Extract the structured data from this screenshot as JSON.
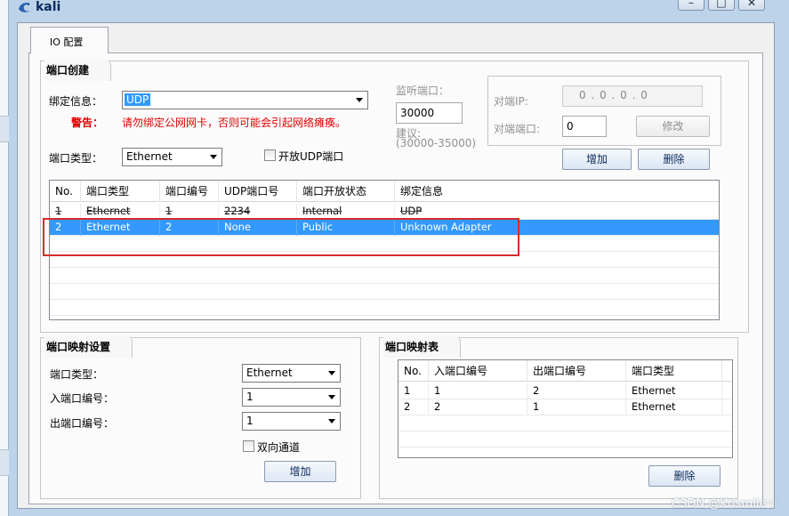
{
  "window": {
    "title": "kali",
    "controls": [
      "–",
      "□",
      "✕"
    ]
  },
  "tabs": [
    {
      "label": "IO 配置"
    }
  ],
  "port_create": {
    "legend": "端口创建",
    "bind_label": "绑定信息：",
    "bind_value": "UDP",
    "warning_label": "警告：",
    "warning_text": "请勿绑定公网网卡，否则可能会引起网络瘫痪。",
    "port_type_label": "端口类型：",
    "port_type_value": "Ethernet",
    "open_udp_label": "开放UDP端口",
    "open_udp_checked": false,
    "listen_port_label": "监听端口：",
    "listen_port_value": "30000",
    "suggest_label": "建议:",
    "suggest_range": "(30000-35000)",
    "peer_ip_label": "对端IP:",
    "peer_ip_value": "0 . 0 . 0 . 0",
    "peer_port_label": "对端端口:",
    "peer_port_value": "0",
    "modify_button": "修改",
    "add_button": "增加",
    "delete_button": "删除"
  },
  "ports_table": {
    "columns": [
      "No.",
      "端口类型",
      "端口编号",
      "UDP端口号",
      "端口开放状态",
      "绑定信息"
    ],
    "rows": [
      {
        "no": "1",
        "type": "Ethernet",
        "num": "1",
        "udp": "2234",
        "status": "Internal",
        "bind": "UDP",
        "selected": false
      },
      {
        "no": "2",
        "type": "Ethernet",
        "num": "2",
        "udp": "None",
        "status": "Public",
        "bind": "Unknown Adapter",
        "selected": true
      }
    ]
  },
  "mapping_settings": {
    "legend": "端口映射设置",
    "port_type_label": "端口类型：",
    "port_type_value": "Ethernet",
    "in_port_label": "入端口编号：",
    "in_port_value": "1",
    "out_port_label": "出端口编号：",
    "out_port_value": "1",
    "bidirectional_label": "双向通道",
    "bidirectional_checked": false,
    "add_button": "增加"
  },
  "mapping_table": {
    "legend": "端口映射表",
    "columns": [
      "No.",
      "入端口编号",
      "出端口编号",
      "端口类型"
    ],
    "rows": [
      {
        "no": "1",
        "in": "1",
        "out": "2",
        "type": "Ethernet"
      },
      {
        "no": "2",
        "in": "2",
        "out": "1",
        "type": "Ethernet"
      }
    ],
    "delete_button": "删除"
  },
  "watermark": "CSDN @Krismile☜",
  "colors": {
    "selection": "#3399ff",
    "warning": "#e00000",
    "annotation": "#d92b2b"
  }
}
